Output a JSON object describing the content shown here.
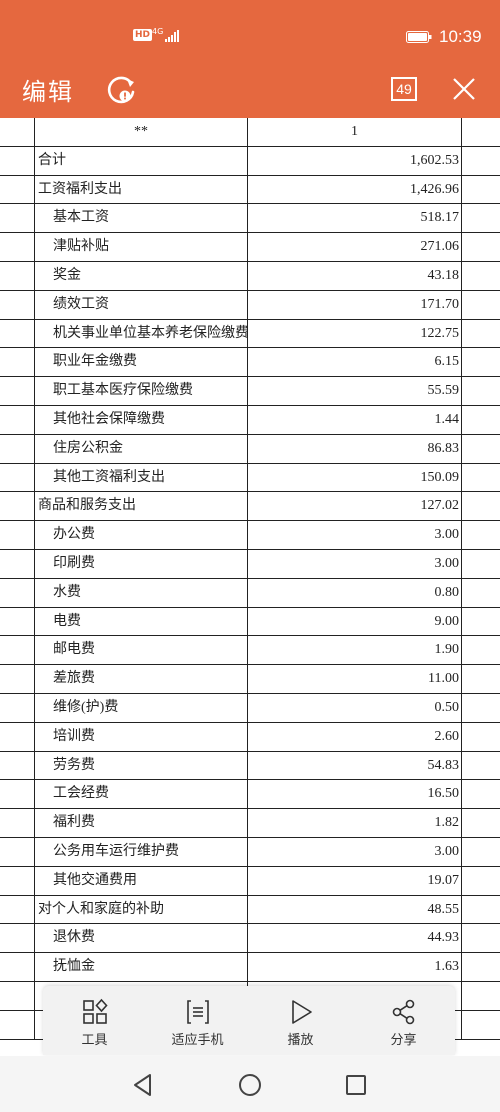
{
  "status_bar": {
    "hd": "HD",
    "network": "4G",
    "time": "10:39"
  },
  "header": {
    "title": "编辑",
    "page_count": "49"
  },
  "colors": {
    "accent": "#e5683f",
    "toolbar_bg": "#f2f2f2",
    "grid": "#222222"
  },
  "table": {
    "header": {
      "name": "**",
      "value": "1"
    },
    "rows": [
      {
        "name": "合计",
        "value": "1,602.53",
        "level": 0
      },
      {
        "name": "工资福利支出",
        "value": "1,426.96",
        "level": 0
      },
      {
        "name": "基本工资",
        "value": "518.17",
        "level": 1
      },
      {
        "name": "津贴补贴",
        "value": "271.06",
        "level": 1
      },
      {
        "name": "奖金",
        "value": "43.18",
        "level": 1
      },
      {
        "name": "绩效工资",
        "value": "171.70",
        "level": 1
      },
      {
        "name": "机关事业单位基本养老保险缴费",
        "value": "122.75",
        "level": 1
      },
      {
        "name": "职业年金缴费",
        "value": "6.15",
        "level": 1
      },
      {
        "name": "职工基本医疗保险缴费",
        "value": "55.59",
        "level": 1
      },
      {
        "name": "其他社会保障缴费",
        "value": "1.44",
        "level": 1
      },
      {
        "name": "住房公积金",
        "value": "86.83",
        "level": 1
      },
      {
        "name": "其他工资福利支出",
        "value": "150.09",
        "level": 1
      },
      {
        "name": "商品和服务支出",
        "value": "127.02",
        "level": 0
      },
      {
        "name": "办公费",
        "value": "3.00",
        "level": 1
      },
      {
        "name": "印刷费",
        "value": "3.00",
        "level": 1
      },
      {
        "name": "水费",
        "value": "0.80",
        "level": 1
      },
      {
        "name": "电费",
        "value": "9.00",
        "level": 1
      },
      {
        "name": "邮电费",
        "value": "1.90",
        "level": 1
      },
      {
        "name": "差旅费",
        "value": "11.00",
        "level": 1
      },
      {
        "name": "维修(护)费",
        "value": "0.50",
        "level": 1
      },
      {
        "name": "培训费",
        "value": "2.60",
        "level": 1
      },
      {
        "name": "劳务费",
        "value": "54.83",
        "level": 1
      },
      {
        "name": "工会经费",
        "value": "16.50",
        "level": 1
      },
      {
        "name": "福利费",
        "value": "1.82",
        "level": 1
      },
      {
        "name": "公务用车运行维护费",
        "value": "3.00",
        "level": 1
      },
      {
        "name": "其他交通费用",
        "value": "19.07",
        "level": 1
      },
      {
        "name": "对个人和家庭的补助",
        "value": "48.55",
        "level": 0
      },
      {
        "name": "退休费",
        "value": "44.93",
        "level": 1
      },
      {
        "name": "抚恤金",
        "value": "1.63",
        "level": 1
      },
      {
        "name": "",
        "value": "",
        "level": 1
      },
      {
        "name": "",
        "value": "",
        "level": 1
      }
    ]
  },
  "toolbar": {
    "items": [
      {
        "label": "工具",
        "icon": "tools-grid-icon"
      },
      {
        "label": "适应手机",
        "icon": "fit-phone-icon"
      },
      {
        "label": "播放",
        "icon": "play-icon"
      },
      {
        "label": "分享",
        "icon": "share-icon"
      }
    ]
  },
  "navbar": {
    "buttons": [
      "back-icon",
      "home-icon",
      "recents-icon"
    ]
  }
}
